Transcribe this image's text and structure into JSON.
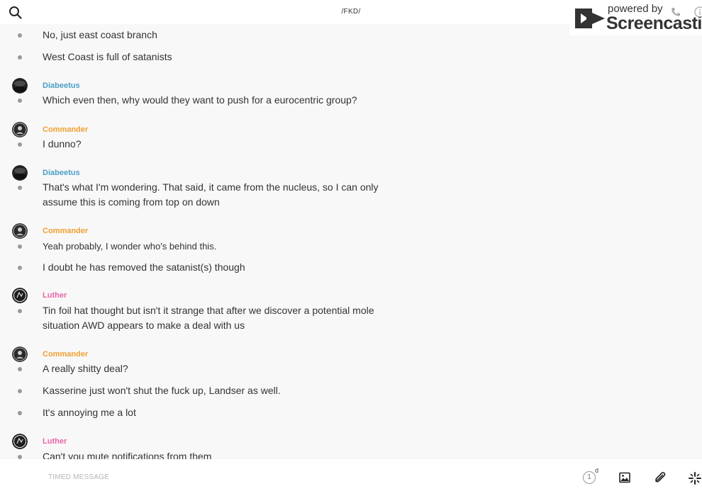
{
  "header": {
    "title": "/FKD/"
  },
  "watermark": {
    "powered": "powered by",
    "brand": "Screencastify"
  },
  "messages": [
    {
      "text": "No, just east coast branch"
    },
    {
      "text": "West Coast is full of satanists"
    },
    {
      "author": "Diabeetus",
      "text": "Which even then, why would they want to push for a eurocentric group?"
    },
    {
      "author": "Commander",
      "text": "I dunno?"
    },
    {
      "author": "Diabeetus",
      "text": "That's what I'm wondering. That said, it came from the nucleus, so I can only assume this is coming from top on down"
    },
    {
      "author": "Commander",
      "text": "Yeah probably, I wonder who's behind this."
    },
    {
      "text": "I doubt he has removed the satanist(s) though"
    },
    {
      "author": "Luther",
      "text": "Tin foil hat thought but isn't it strange that after we discover a potential mole situation AWD appears to make a deal with us"
    },
    {
      "author": "Commander",
      "text": "A really shitty deal?"
    },
    {
      "text": "Kasserine just won't shut the fuck up, Landser as well."
    },
    {
      "text": "It's annoying me a lot"
    },
    {
      "author": "Luther",
      "text": "Can't you mute notifications from them"
    }
  ],
  "composer": {
    "placeholder": "TIMED MESSAGE",
    "timer_value": "1",
    "timer_unit": "d"
  },
  "colors": {
    "diabeetus": "#4a9fc8",
    "commander": "#f0a030",
    "luther": "#e667a8"
  },
  "icons": {
    "search": "search-icon",
    "image": "image-icon",
    "attach": "paperclip-icon",
    "sparkle": "sparkle-icon"
  }
}
